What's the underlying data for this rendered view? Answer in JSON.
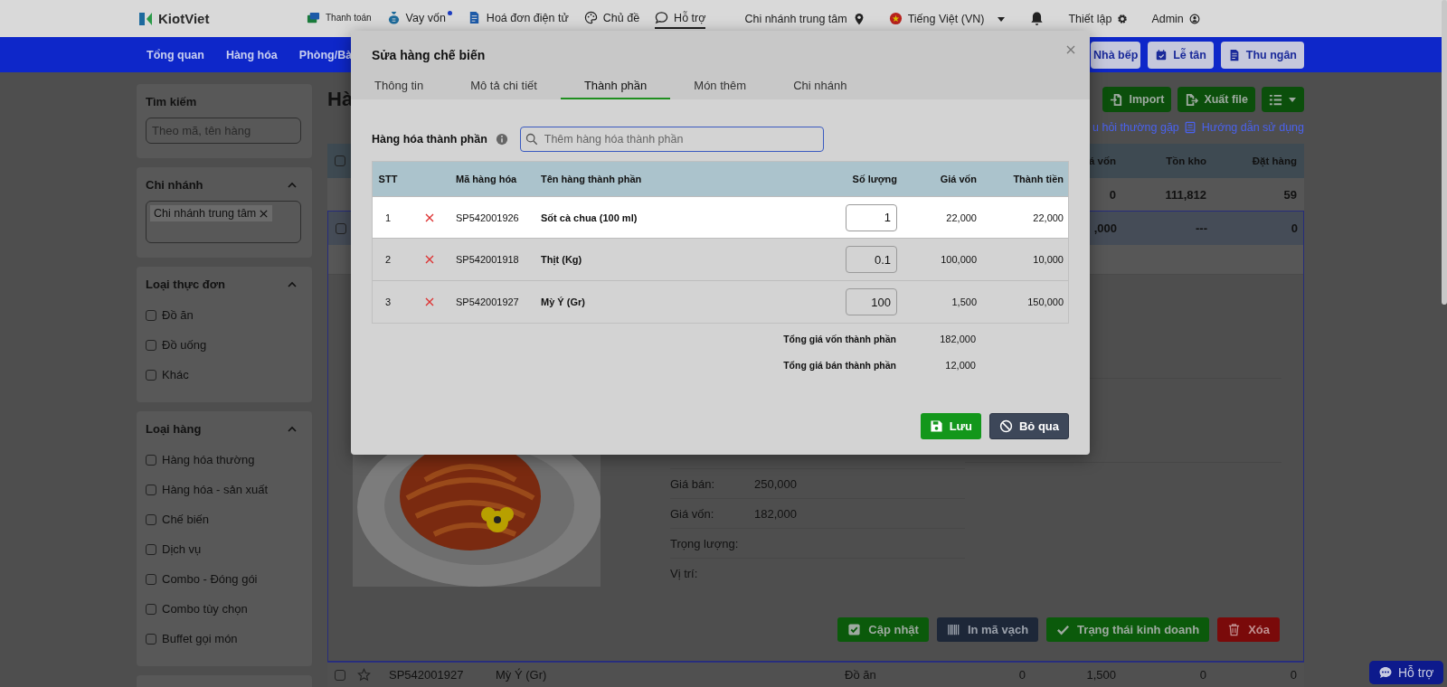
{
  "header": {
    "logo": "KiotViet",
    "menu": [
      {
        "kind": "payment",
        "label": "Thanh toán",
        "notification": false,
        "selected": false
      },
      {
        "kind": "loan",
        "label": "Vay vốn",
        "notification": true,
        "selected": false
      },
      {
        "kind": "invoice",
        "label": "Hoá đơn điện tử",
        "notification": false,
        "selected": false
      },
      {
        "kind": "theme",
        "label": "Chủ đề",
        "notification": false,
        "selected": false
      },
      {
        "kind": "support",
        "label": "Hỗ trợ",
        "notification": false,
        "selected": true
      }
    ],
    "branch": "Chi nhánh trung tâm",
    "language": "Tiếng Việt (VN)",
    "settings": "Thiết lập",
    "user": "Admin"
  },
  "nav": {
    "items": [
      "Tổng quan",
      "Hàng hóa",
      "Phòng/Bà"
    ],
    "buttons": [
      {
        "kind": "kitchen",
        "label": "Nhà bếp"
      },
      {
        "kind": "reception",
        "label": "Lễ tân"
      },
      {
        "kind": "cashier",
        "label": "Thu ngân"
      }
    ]
  },
  "sidebar": [
    {
      "kind": "search",
      "title": "Tìm kiếm",
      "placeholder": "Theo mã, tên hàng"
    },
    {
      "kind": "tags",
      "title": "Chi nhánh",
      "expanded": true,
      "tags": [
        "Chi nhánh trung tâm"
      ]
    },
    {
      "kind": "checklist",
      "title": "Loại thực đơn",
      "expanded": true,
      "options": [
        {
          "label": "Đồ ăn",
          "checked": false
        },
        {
          "label": "Đồ uống",
          "checked": false
        },
        {
          "label": "Khác",
          "checked": false
        }
      ]
    },
    {
      "kind": "checklist",
      "title": "Loại hàng",
      "expanded": true,
      "options": [
        {
          "label": "Hàng hóa thường",
          "checked": false
        },
        {
          "label": "Hàng hóa - sản xuất",
          "checked": false
        },
        {
          "label": "Chế biến",
          "checked": false
        },
        {
          "label": "Dịch vụ",
          "checked": false
        },
        {
          "label": "Combo - Đóng gói",
          "checked": false
        },
        {
          "label": "Combo tùy chọn",
          "checked": false
        },
        {
          "label": "Buffet gọi món",
          "checked": false
        }
      ]
    }
  ],
  "main": {
    "title": "Hà",
    "actions": [
      {
        "kind": "import",
        "label": "Import"
      },
      {
        "kind": "export",
        "label": "Xuất file"
      },
      {
        "kind": "view"
      }
    ],
    "links": [
      {
        "kind": "plain",
        "label": "u hỏi thường gặp"
      },
      {
        "kind": "guide",
        "label": "Hướng dẫn sử dụng"
      }
    ],
    "table": {
      "header_checked": false,
      "columns": [
        "á vốn",
        "Tồn kho",
        "Đặt hàng"
      ],
      "rows": [
        {
          "kind": "summary",
          "selected": false,
          "values": [
            "0",
            "111,812",
            "59"
          ]
        },
        {
          "kind": "product",
          "selected": true,
          "checked": false,
          "values": [
            ",000",
            "---",
            "0"
          ]
        },
        {
          "kind": "product",
          "selected": false,
          "checked": false,
          "starred": false,
          "code": "SP542001927",
          "name": "Mỳ Ý (Gr)",
          "menu_type": "Đồ ăn",
          "values": [
            "0",
            "1,500",
            "0",
            "0"
          ]
        }
      ]
    },
    "detail": {
      "fields": [
        {
          "label": "Giá bán:",
          "value": "250,000"
        },
        {
          "label": "Giá vốn:",
          "value": "182,000"
        },
        {
          "label": "Trọng lượng:"
        },
        {
          "label": "Vị trí:"
        }
      ],
      "actions": [
        {
          "kind": "update",
          "label": "Cập nhật"
        },
        {
          "kind": "barcode",
          "label": "In mã vạch"
        },
        {
          "kind": "status",
          "label": "Trạng thái kinh doanh"
        },
        {
          "kind": "delete",
          "label": "Xóa"
        }
      ]
    }
  },
  "modal": {
    "title": "Sửa hàng chế biến",
    "tabs": [
      {
        "label": "Thông tin",
        "selected": false
      },
      {
        "label": "Mô tả chi tiết",
        "selected": false
      },
      {
        "label": "Thành phần",
        "selected": true
      },
      {
        "label": "Món thêm",
        "selected": false
      },
      {
        "label": "Chi nhánh",
        "selected": false
      }
    ],
    "ingredient_label": "Hàng hóa thành phần",
    "search": {
      "placeholder": "Thêm hàng hóa thành phần"
    },
    "columns": [
      "STT",
      "Mã hàng hóa",
      "Tên hàng thành phần",
      "Số lượng",
      "Giá vốn",
      "Thành tiền"
    ],
    "rows": [
      {
        "stt": "1",
        "code": "SP542001926",
        "name": "Sốt cà chua (100 ml)",
        "quantity": "1",
        "cost": "22,000",
        "total": "22,000",
        "selected": true
      },
      {
        "stt": "2",
        "code": "SP542001918",
        "name": "Thịt (Kg)",
        "quantity": "0.1",
        "cost": "100,000",
        "total": "10,000",
        "selected": false
      },
      {
        "stt": "3",
        "code": "SP542001927",
        "name": "Mỳ Ý (Gr)",
        "quantity": "100",
        "cost": "1,500",
        "total": "150,000",
        "selected": false
      }
    ],
    "totals": [
      {
        "label": "Tổng giá vốn thành phần",
        "value": "182,000"
      },
      {
        "label": "Tổng giá bán thành phần",
        "value": "12,000"
      }
    ],
    "buttons": [
      {
        "kind": "save",
        "label": "Lưu"
      },
      {
        "kind": "cancel",
        "label": "Bỏ qua"
      }
    ]
  },
  "chat_button": "Hỗ trợ"
}
